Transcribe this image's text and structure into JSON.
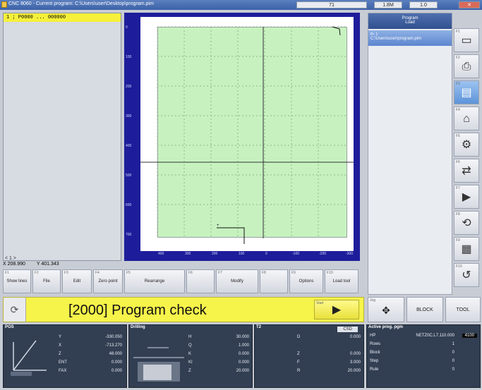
{
  "window": {
    "title": "CNC 8060 - Current program: C:\\Users\\user\\Desktop\\program.pim",
    "field_value": "71",
    "field2": "1.8M",
    "field3": "1.0"
  },
  "code_panel": {
    "line1_no": "1",
    "line1_text": "; P0000 ... 000000",
    "line_counter": "< 1 >"
  },
  "graph": {
    "y_ticks": [
      "0",
      "100",
      "200",
      "300",
      "400",
      "500",
      "600",
      "700"
    ],
    "x_ticks": [
      "400",
      "300",
      "200",
      "100",
      "0",
      "-100",
      "-200",
      "-300"
    ]
  },
  "coords": {
    "x": "X 208.990",
    "y": "Y 401.343"
  },
  "softkeys": [
    {
      "fk": "F1",
      "label": "Show lines"
    },
    {
      "fk": "F2",
      "label": "File"
    },
    {
      "fk": "F3",
      "label": "Edit"
    },
    {
      "fk": "F4",
      "label": "Zero point"
    },
    {
      "fk": "F5",
      "label": "Rearrange"
    },
    {
      "fk": "F6",
      "label": ""
    },
    {
      "fk": "F7",
      "label": "Modify"
    },
    {
      "fk": "F8",
      "label": ""
    },
    {
      "fk": "F9",
      "label": "Options"
    },
    {
      "fk": "F10",
      "label": "Load tool"
    }
  ],
  "right_panel": {
    "header_line1": "Program",
    "header_line2": "Load",
    "tab_label": "Pr. 1",
    "selected_item": "C:\\Users\\user\\program.pim"
  },
  "vertical_keys": [
    {
      "fk": "F1",
      "icon": "monitor-icon"
    },
    {
      "fk": "F2",
      "icon": "save-icon"
    },
    {
      "fk": "F3",
      "icon": "document-icon"
    },
    {
      "fk": "F4",
      "icon": "machine-icon"
    },
    {
      "fk": "F5",
      "icon": "tool-icon"
    },
    {
      "fk": "F6",
      "icon": "tool-change-icon"
    },
    {
      "fk": "F7",
      "icon": "play-icon"
    },
    {
      "fk": "F8",
      "icon": "loop-icon"
    },
    {
      "fk": "F9",
      "icon": "sheet-icon"
    },
    {
      "fk": "F10",
      "icon": "chart-icon"
    }
  ],
  "mode": {
    "label": "[2000] Program check",
    "start_fk": "Start",
    "start_glyph": "▶",
    "jog_label": "Jog",
    "block_label": "BLOCK",
    "tool_label": "TOOL"
  },
  "pos_panel": {
    "title": "POS",
    "rows": [
      {
        "k": "Y",
        "v": "-330.050"
      },
      {
        "k": "X",
        "v": "-713.270"
      },
      {
        "k": "Z",
        "v": "48.000"
      },
      {
        "k": "ENT",
        "v": "0.000"
      },
      {
        "k": "FAX",
        "v": "0.000"
      }
    ]
  },
  "drill_panel": {
    "title": "Drilling",
    "rows": [
      {
        "k": "H",
        "v": "30.000"
      },
      {
        "k": "Q",
        "v": "1.000"
      },
      {
        "k": "K",
        "v": "0.000"
      },
      {
        "k": "KI",
        "v": "0.000"
      },
      {
        "k": "Z",
        "v": "20.000"
      }
    ]
  },
  "t2_panel": {
    "title": "T2",
    "badge": "CSD",
    "rows": [
      {
        "k": "D",
        "v": "0.000"
      },
      {
        "k": "",
        "v": ""
      },
      {
        "k": "Z",
        "v": "0.000"
      },
      {
        "k": "F",
        "v": "3.000"
      },
      {
        "k": "R",
        "v": "20.000"
      }
    ]
  },
  "prog_panel": {
    "title": "Active prog. pgm",
    "rows": [
      {
        "k": "HP",
        "v": "NETZ0C.L7.110.000"
      },
      {
        "k": "Rows",
        "v": "1"
      },
      {
        "k": "Block",
        "v": "0"
      },
      {
        "k": "Step",
        "v": "0"
      },
      {
        "k": "Rule",
        "v": "0"
      }
    ],
    "hp_badge": "4100"
  },
  "colors": {
    "graph_bg": "#1d1d9b",
    "work_area": "#c7f2c0",
    "mode_bar": "#f6f34a",
    "panel_dark": "#323f52"
  }
}
